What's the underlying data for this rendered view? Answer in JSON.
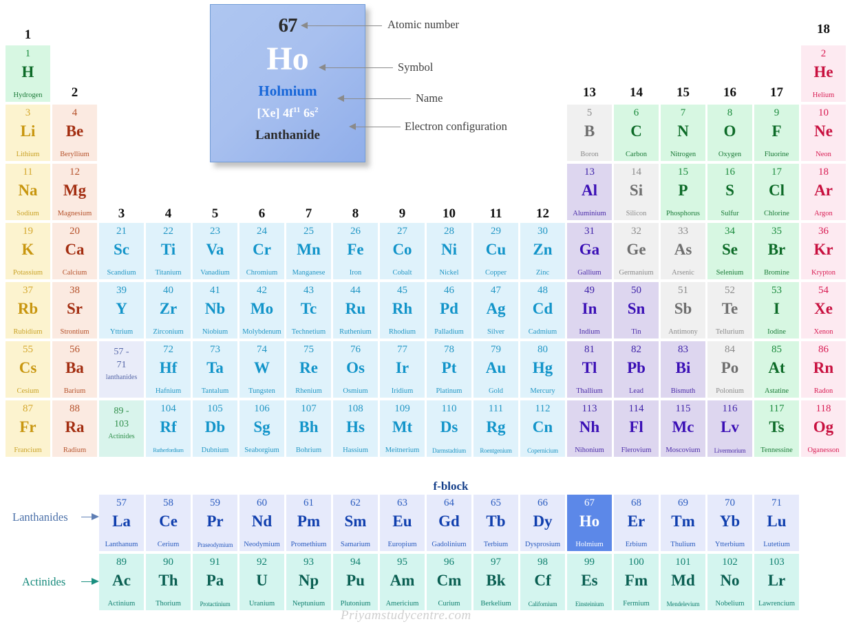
{
  "legend": {
    "atomic_number": "67",
    "symbol": "Ho",
    "name": "Holmium",
    "config_main": "[Xe] 4f",
    "config_sup1": "11",
    "config_mid": " 6s",
    "config_sup2": "2",
    "category": "Lanthanide",
    "callouts": {
      "atomic_number": "Atomic number",
      "symbol": "Symbol",
      "name": "Name",
      "electron_configuration": "Electron configuration"
    }
  },
  "group_numbers": [
    "1",
    "2",
    "3",
    "4",
    "5",
    "6",
    "7",
    "8",
    "9",
    "10",
    "11",
    "12",
    "13",
    "14",
    "15",
    "16",
    "17",
    "18"
  ],
  "fblock_label": "f-block",
  "side_labels": {
    "lanthanides": "Lanthanides",
    "actinides": "Actinides"
  },
  "watermark": "Priyamstudycentre.com",
  "placeholders": [
    {
      "range_top": "57 -",
      "range_bottom": "71",
      "label": "lanthanides",
      "cat": "lanthph"
    },
    {
      "range_top": "89 -",
      "range_bottom": "103",
      "label": "Actinides",
      "cat": "actinph"
    }
  ],
  "elements": [
    {
      "z": "1",
      "sym": "H",
      "name": "Hydrogen",
      "cat": "nonmetal",
      "col": 1,
      "row": 1
    },
    {
      "z": "2",
      "sym": "He",
      "name": "Helium",
      "cat": "noble",
      "col": 18,
      "row": 1
    },
    {
      "z": "3",
      "sym": "Li",
      "name": "Lithium",
      "cat": "alkali",
      "col": 1,
      "row": 2
    },
    {
      "z": "4",
      "sym": "Be",
      "name": "Beryllium",
      "cat": "alkaline",
      "col": 2,
      "row": 2
    },
    {
      "z": "5",
      "sym": "B",
      "name": "Boron",
      "cat": "metalloid",
      "col": 13,
      "row": 2
    },
    {
      "z": "6",
      "sym": "C",
      "name": "Carbon",
      "cat": "nonmetal",
      "col": 14,
      "row": 2
    },
    {
      "z": "7",
      "sym": "N",
      "name": "Nitrogen",
      "cat": "nonmetal",
      "col": 15,
      "row": 2
    },
    {
      "z": "8",
      "sym": "O",
      "name": "Oxygen",
      "cat": "nonmetal",
      "col": 16,
      "row": 2
    },
    {
      "z": "9",
      "sym": "F",
      "name": "Fluorine",
      "cat": "nonmetal",
      "col": 17,
      "row": 2
    },
    {
      "z": "10",
      "sym": "Ne",
      "name": "Neon",
      "cat": "noble",
      "col": 18,
      "row": 2
    },
    {
      "z": "11",
      "sym": "Na",
      "name": "Sodium",
      "cat": "alkali",
      "col": 1,
      "row": 3
    },
    {
      "z": "12",
      "sym": "Mg",
      "name": "Magnesium",
      "cat": "alkaline",
      "col": 2,
      "row": 3
    },
    {
      "z": "13",
      "sym": "Al",
      "name": "Aluminium",
      "cat": "posttrans",
      "col": 13,
      "row": 3
    },
    {
      "z": "14",
      "sym": "Si",
      "name": "Silicon",
      "cat": "metalloid",
      "col": 14,
      "row": 3
    },
    {
      "z": "15",
      "sym": "P",
      "name": "Phosphorus",
      "cat": "nonmetal",
      "col": 15,
      "row": 3
    },
    {
      "z": "16",
      "sym": "S",
      "name": "Sulfur",
      "cat": "nonmetal",
      "col": 16,
      "row": 3
    },
    {
      "z": "17",
      "sym": "Cl",
      "name": "Chlorine",
      "cat": "nonmetal",
      "col": 17,
      "row": 3
    },
    {
      "z": "18",
      "sym": "Ar",
      "name": "Argon",
      "cat": "noble",
      "col": 18,
      "row": 3
    },
    {
      "z": "19",
      "sym": "K",
      "name": "Potassium",
      "cat": "alkali",
      "col": 1,
      "row": 4
    },
    {
      "z": "20",
      "sym": "Ca",
      "name": "Calcium",
      "cat": "alkaline",
      "col": 2,
      "row": 4
    },
    {
      "z": "21",
      "sym": "Sc",
      "name": "Scandium",
      "cat": "transition",
      "col": 3,
      "row": 4
    },
    {
      "z": "22",
      "sym": "Ti",
      "name": "Titanium",
      "cat": "transition",
      "col": 4,
      "row": 4
    },
    {
      "z": "23",
      "sym": "Va",
      "name": "Vanadium",
      "cat": "transition",
      "col": 5,
      "row": 4
    },
    {
      "z": "24",
      "sym": "Cr",
      "name": "Chromium",
      "cat": "transition",
      "col": 6,
      "row": 4
    },
    {
      "z": "25",
      "sym": "Mn",
      "name": "Manganese",
      "cat": "transition",
      "col": 7,
      "row": 4
    },
    {
      "z": "26",
      "sym": "Fe",
      "name": "Iron",
      "cat": "transition",
      "col": 8,
      "row": 4
    },
    {
      "z": "27",
      "sym": "Co",
      "name": "Cobalt",
      "cat": "transition",
      "col": 9,
      "row": 4
    },
    {
      "z": "28",
      "sym": "Ni",
      "name": "Nickel",
      "cat": "transition",
      "col": 10,
      "row": 4
    },
    {
      "z": "29",
      "sym": "Cu",
      "name": "Copper",
      "cat": "transition",
      "col": 11,
      "row": 4
    },
    {
      "z": "30",
      "sym": "Zn",
      "name": "Zinc",
      "cat": "transition",
      "col": 12,
      "row": 4
    },
    {
      "z": "31",
      "sym": "Ga",
      "name": "Gallium",
      "cat": "posttrans",
      "col": 13,
      "row": 4
    },
    {
      "z": "32",
      "sym": "Ge",
      "name": "Germanium",
      "cat": "metalloid",
      "col": 14,
      "row": 4
    },
    {
      "z": "33",
      "sym": "As",
      "name": "Arsenic",
      "cat": "metalloid",
      "col": 15,
      "row": 4
    },
    {
      "z": "34",
      "sym": "Se",
      "name": "Selenium",
      "cat": "nonmetal",
      "col": 16,
      "row": 4
    },
    {
      "z": "35",
      "sym": "Br",
      "name": "Bromine",
      "cat": "nonmetal",
      "col": 17,
      "row": 4
    },
    {
      "z": "36",
      "sym": "Kr",
      "name": "Krypton",
      "cat": "noble",
      "col": 18,
      "row": 4
    },
    {
      "z": "37",
      "sym": "Rb",
      "name": "Rubidium",
      "cat": "alkali",
      "col": 1,
      "row": 5
    },
    {
      "z": "38",
      "sym": "Sr",
      "name": "Strontium",
      "cat": "alkaline",
      "col": 2,
      "row": 5
    },
    {
      "z": "39",
      "sym": "Y",
      "name": "Yttrium",
      "cat": "transition",
      "col": 3,
      "row": 5
    },
    {
      "z": "40",
      "sym": "Zr",
      "name": "Zirconium",
      "cat": "transition",
      "col": 4,
      "row": 5
    },
    {
      "z": "41",
      "sym": "Nb",
      "name": "Niobium",
      "cat": "transition",
      "col": 5,
      "row": 5
    },
    {
      "z": "42",
      "sym": "Mo",
      "name": "Molybdenum",
      "cat": "transition",
      "col": 6,
      "row": 5
    },
    {
      "z": "43",
      "sym": "Tc",
      "name": "Technetium",
      "cat": "transition",
      "col": 7,
      "row": 5
    },
    {
      "z": "44",
      "sym": "Ru",
      "name": "Ruthenium",
      "cat": "transition",
      "col": 8,
      "row": 5
    },
    {
      "z": "45",
      "sym": "Rh",
      "name": "Rhodium",
      "cat": "transition",
      "col": 9,
      "row": 5
    },
    {
      "z": "46",
      "sym": "Pd",
      "name": "Palladium",
      "cat": "transition",
      "col": 10,
      "row": 5
    },
    {
      "z": "47",
      "sym": "Ag",
      "name": "Silver",
      "cat": "transition",
      "col": 11,
      "row": 5
    },
    {
      "z": "48",
      "sym": "Cd",
      "name": "Cadmium",
      "cat": "transition",
      "col": 12,
      "row": 5
    },
    {
      "z": "49",
      "sym": "In",
      "name": "Indium",
      "cat": "posttrans",
      "col": 13,
      "row": 5
    },
    {
      "z": "50",
      "sym": "Sn",
      "name": "Tin",
      "cat": "posttrans",
      "col": 14,
      "row": 5
    },
    {
      "z": "51",
      "sym": "Sb",
      "name": "Antimony",
      "cat": "metalloid",
      "col": 15,
      "row": 5
    },
    {
      "z": "52",
      "sym": "Te",
      "name": "Tellurium",
      "cat": "metalloid",
      "col": 16,
      "row": 5
    },
    {
      "z": "53",
      "sym": "I",
      "name": "Iodine",
      "cat": "nonmetal",
      "col": 17,
      "row": 5
    },
    {
      "z": "54",
      "sym": "Xe",
      "name": "Xenon",
      "cat": "noble",
      "col": 18,
      "row": 5
    },
    {
      "z": "55",
      "sym": "Cs",
      "name": "Cesium",
      "cat": "alkali",
      "col": 1,
      "row": 6
    },
    {
      "z": "56",
      "sym": "Ba",
      "name": "Barium",
      "cat": "alkaline",
      "col": 2,
      "row": 6
    },
    {
      "z": "72",
      "sym": "Hf",
      "name": "Hafnium",
      "cat": "transition",
      "col": 4,
      "row": 6
    },
    {
      "z": "73",
      "sym": "Ta",
      "name": "Tantalum",
      "cat": "transition",
      "col": 5,
      "row": 6
    },
    {
      "z": "74",
      "sym": "W",
      "name": "Tungsten",
      "cat": "transition",
      "col": 6,
      "row": 6
    },
    {
      "z": "75",
      "sym": "Re",
      "name": "Rhenium",
      "cat": "transition",
      "col": 7,
      "row": 6
    },
    {
      "z": "76",
      "sym": "Os",
      "name": "Osmium",
      "cat": "transition",
      "col": 8,
      "row": 6
    },
    {
      "z": "77",
      "sym": "Ir",
      "name": "Iridium",
      "cat": "transition",
      "col": 9,
      "row": 6
    },
    {
      "z": "78",
      "sym": "Pt",
      "name": "Platinum",
      "cat": "transition",
      "col": 10,
      "row": 6
    },
    {
      "z": "79",
      "sym": "Au",
      "name": "Gold",
      "cat": "transition",
      "col": 11,
      "row": 6
    },
    {
      "z": "80",
      "sym": "Hg",
      "name": "Mercury",
      "cat": "transition",
      "col": 12,
      "row": 6
    },
    {
      "z": "81",
      "sym": "Tl",
      "name": "Thallium",
      "cat": "posttrans",
      "col": 13,
      "row": 6
    },
    {
      "z": "82",
      "sym": "Pb",
      "name": "Lead",
      "cat": "posttrans",
      "col": 14,
      "row": 6
    },
    {
      "z": "83",
      "sym": "Bi",
      "name": "Bismuth",
      "cat": "posttrans",
      "col": 15,
      "row": 6
    },
    {
      "z": "84",
      "sym": "Po",
      "name": "Polonium",
      "cat": "metalloid",
      "col": 16,
      "row": 6
    },
    {
      "z": "85",
      "sym": "At",
      "name": "Astatine",
      "cat": "nonmetal",
      "col": 17,
      "row": 6
    },
    {
      "z": "86",
      "sym": "Rn",
      "name": "Radon",
      "cat": "noble",
      "col": 18,
      "row": 6
    },
    {
      "z": "87",
      "sym": "Fr",
      "name": "Francium",
      "cat": "alkali",
      "col": 1,
      "row": 7
    },
    {
      "z": "88",
      "sym": "Ra",
      "name": "Radium",
      "cat": "alkaline",
      "col": 2,
      "row": 7
    },
    {
      "z": "104",
      "sym": "Rf",
      "name": "Rutherfordium",
      "cat": "transition",
      "col": 4,
      "row": 7
    },
    {
      "z": "105",
      "sym": "Db",
      "name": "Dubnium",
      "cat": "transition",
      "col": 5,
      "row": 7
    },
    {
      "z": "106",
      "sym": "Sg",
      "name": "Seaborgium",
      "cat": "transition",
      "col": 6,
      "row": 7
    },
    {
      "z": "107",
      "sym": "Bh",
      "name": "Bohrium",
      "cat": "transition",
      "col": 7,
      "row": 7
    },
    {
      "z": "108",
      "sym": "Hs",
      "name": "Hassium",
      "cat": "transition",
      "col": 8,
      "row": 7
    },
    {
      "z": "109",
      "sym": "Mt",
      "name": "Meitnerium",
      "cat": "transition",
      "col": 9,
      "row": 7
    },
    {
      "z": "110",
      "sym": "Ds",
      "name": "Darmstadtium",
      "cat": "transition",
      "col": 10,
      "row": 7
    },
    {
      "z": "111",
      "sym": "Rg",
      "name": "Roentgenium",
      "cat": "transition",
      "col": 11,
      "row": 7
    },
    {
      "z": "112",
      "sym": "Cn",
      "name": "Copernicium",
      "cat": "transition",
      "col": 12,
      "row": 7
    },
    {
      "z": "113",
      "sym": "Nh",
      "name": "Nihonium",
      "cat": "posttrans",
      "col": 13,
      "row": 7
    },
    {
      "z": "114",
      "sym": "Fl",
      "name": "Flerovium",
      "cat": "posttrans",
      "col": 14,
      "row": 7
    },
    {
      "z": "115",
      "sym": "Mc",
      "name": "Moscovium",
      "cat": "posttrans",
      "col": 15,
      "row": 7
    },
    {
      "z": "116",
      "sym": "Lv",
      "name": "Livermorium",
      "cat": "posttrans",
      "col": 16,
      "row": 7
    },
    {
      "z": "117",
      "sym": "Ts",
      "name": "Tennessine",
      "cat": "nonmetal",
      "col": 17,
      "row": 7
    },
    {
      "z": "118",
      "sym": "Og",
      "name": "Oganesson",
      "cat": "noble",
      "col": 18,
      "row": 7
    }
  ],
  "lanthanides": [
    {
      "z": "57",
      "sym": "La",
      "name": "Lanthanum",
      "cat": "lanth"
    },
    {
      "z": "58",
      "sym": "Ce",
      "name": "Cerium",
      "cat": "lanth"
    },
    {
      "z": "59",
      "sym": "Pr",
      "name": "Praseodymium",
      "cat": "lanth"
    },
    {
      "z": "60",
      "sym": "Nd",
      "name": "Neodymium",
      "cat": "lanth"
    },
    {
      "z": "61",
      "sym": "Pm",
      "name": "Promethium",
      "cat": "lanth"
    },
    {
      "z": "62",
      "sym": "Sm",
      "name": "Samarium",
      "cat": "lanth"
    },
    {
      "z": "63",
      "sym": "Eu",
      "name": "Europium",
      "cat": "lanth"
    },
    {
      "z": "64",
      "sym": "Gd",
      "name": "Gadolinium",
      "cat": "lanth"
    },
    {
      "z": "65",
      "sym": "Tb",
      "name": "Terbium",
      "cat": "lanth"
    },
    {
      "z": "66",
      "sym": "Dy",
      "name": "Dysprosium",
      "cat": "lanth"
    },
    {
      "z": "67",
      "sym": "Ho",
      "name": "Holmium",
      "cat": "lanth",
      "highlight": true
    },
    {
      "z": "68",
      "sym": "Er",
      "name": "Erbium",
      "cat": "lanth"
    },
    {
      "z": "69",
      "sym": "Tm",
      "name": "Thulium",
      "cat": "lanth"
    },
    {
      "z": "70",
      "sym": "Yb",
      "name": "Ytterbium",
      "cat": "lanth"
    },
    {
      "z": "71",
      "sym": "Lu",
      "name": "Lutetium",
      "cat": "lanth"
    }
  ],
  "actinides": [
    {
      "z": "89",
      "sym": "Ac",
      "name": "Actinium",
      "cat": "actin"
    },
    {
      "z": "90",
      "sym": "Th",
      "name": "Thorium",
      "cat": "actin"
    },
    {
      "z": "91",
      "sym": "Pa",
      "name": "Protactinium",
      "cat": "actin"
    },
    {
      "z": "92",
      "sym": "U",
      "name": "Uranium",
      "cat": "actin"
    },
    {
      "z": "93",
      "sym": "Np",
      "name": "Neptunium",
      "cat": "actin"
    },
    {
      "z": "94",
      "sym": "Pu",
      "name": "Plutonium",
      "cat": "actin"
    },
    {
      "z": "95",
      "sym": "Am",
      "name": "Americium",
      "cat": "actin"
    },
    {
      "z": "96",
      "sym": "Cm",
      "name": "Curium",
      "cat": "actin"
    },
    {
      "z": "97",
      "sym": "Bk",
      "name": "Berkelium",
      "cat": "actin"
    },
    {
      "z": "98",
      "sym": "Cf",
      "name": "Californium",
      "cat": "actin"
    },
    {
      "z": "99",
      "sym": "Es",
      "name": "Einsteinium",
      "cat": "actin"
    },
    {
      "z": "100",
      "sym": "Fm",
      "name": "Fermium",
      "cat": "actin"
    },
    {
      "z": "101",
      "sym": "Md",
      "name": "Mendelevium",
      "cat": "actin"
    },
    {
      "z": "102",
      "sym": "No",
      "name": "Nobelium",
      "cat": "actin"
    },
    {
      "z": "103",
      "sym": "Lr",
      "name": "Lawrencium",
      "cat": "actin"
    }
  ]
}
